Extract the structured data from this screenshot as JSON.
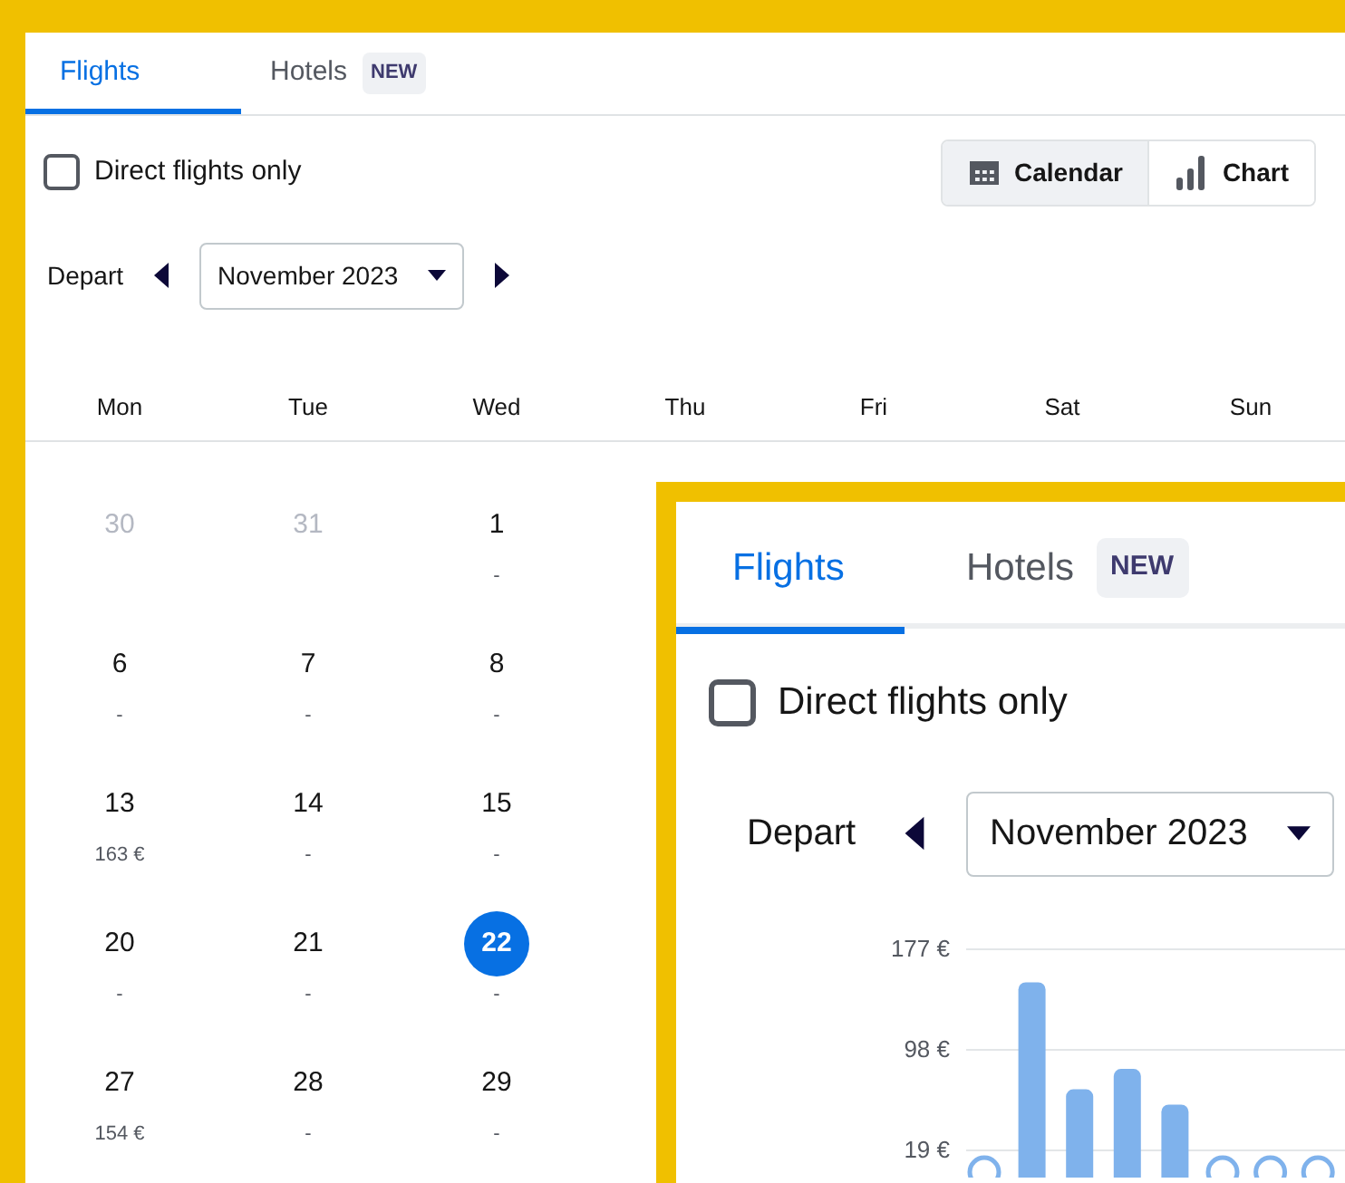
{
  "back_panel": {
    "tabs": [
      {
        "label": "Flights",
        "selected": true
      },
      {
        "label": "Hotels",
        "badge": "NEW",
        "selected": false
      }
    ],
    "direct_flights": {
      "label": "Direct flights only",
      "checked": false
    },
    "views": [
      {
        "kind": "calendar",
        "label": "Calendar",
        "selected": true
      },
      {
        "kind": "chart",
        "label": "Chart",
        "selected": false
      }
    ],
    "depart": {
      "label": "Depart",
      "month": "November 2023"
    },
    "weekdays": [
      "Mon",
      "Tue",
      "Wed",
      "Thu",
      "Fri",
      "Sat",
      "Sun"
    ],
    "weeks": [
      [
        {
          "day": "30",
          "muted": true,
          "selected": false
        },
        {
          "day": "31",
          "muted": true,
          "selected": false
        },
        {
          "day": "1",
          "price": "-",
          "muted": false,
          "selected": false
        }
      ],
      [
        {
          "day": "6",
          "price": "-",
          "muted": false,
          "selected": false
        },
        {
          "day": "7",
          "price": "-",
          "muted": false,
          "selected": false
        },
        {
          "day": "8",
          "price": "-",
          "muted": false,
          "selected": false
        }
      ],
      [
        {
          "day": "13",
          "price": "163 €",
          "muted": false,
          "selected": false
        },
        {
          "day": "14",
          "price": "-",
          "muted": false,
          "selected": false
        },
        {
          "day": "15",
          "price": "-",
          "muted": false,
          "selected": false
        }
      ],
      [
        {
          "day": "20",
          "price": "-",
          "muted": false,
          "selected": false
        },
        {
          "day": "21",
          "price": "-",
          "muted": false,
          "selected": false
        },
        {
          "day": "22",
          "price": "-",
          "muted": false,
          "selected": true
        }
      ],
      [
        {
          "day": "27",
          "price": "154 €",
          "muted": false,
          "selected": false
        },
        {
          "day": "28",
          "price": "-",
          "muted": false,
          "selected": false
        },
        {
          "day": "29",
          "price": "-",
          "muted": false,
          "selected": false
        }
      ]
    ]
  },
  "front_panel": {
    "tabs": [
      {
        "label": "Flights",
        "selected": true
      },
      {
        "label": "Hotels",
        "badge": "NEW",
        "selected": false
      }
    ],
    "direct_flights": {
      "label": "Direct flights only",
      "checked": false
    },
    "depart": {
      "label": "Depart",
      "month": "November 2023"
    },
    "chart_data": {
      "type": "bar",
      "ylim": [
        19,
        177
      ],
      "yticks": [
        {
          "value": 177,
          "label": "177 €"
        },
        {
          "value": 98,
          "label": "98 €"
        },
        {
          "value": 19,
          "label": "19 €"
        }
      ],
      "series": [
        {
          "color": "#7fb2ec",
          "values": [
            null,
            151,
            67,
            83,
            55,
            null,
            null,
            null
          ]
        }
      ]
    }
  }
}
